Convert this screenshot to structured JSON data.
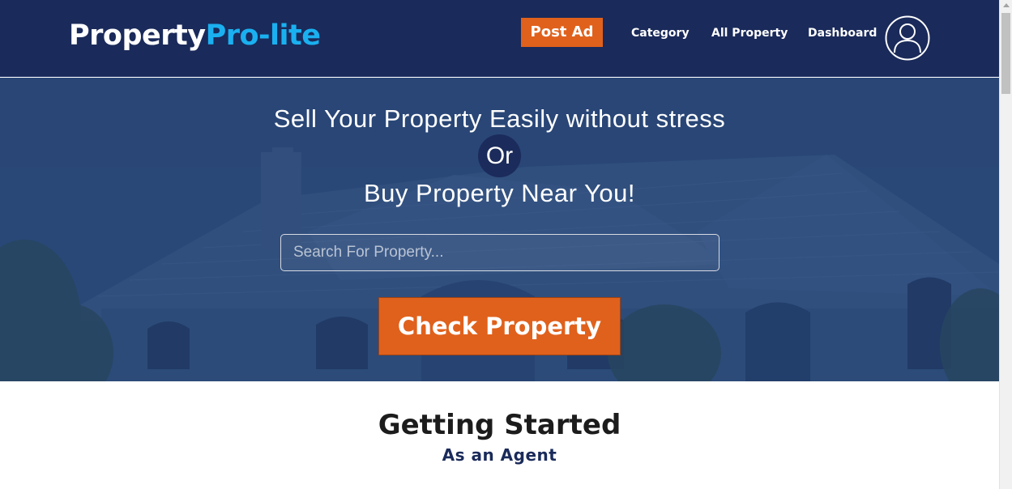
{
  "header": {
    "logo_part1": "Property",
    "logo_part2": "Pro-lite",
    "post_ad_label": "Post Ad",
    "nav": {
      "category": "Category",
      "all_property": "All Property",
      "dashboard": "Dashboard"
    },
    "avatar_icon": "user-avatar-icon"
  },
  "hero": {
    "line1": "Sell Your Property Easily without stress",
    "or": "Or",
    "line3": "Buy Property Near You!",
    "search_placeholder": "Search For Property...",
    "search_value": "",
    "check_button_label": "Check Property"
  },
  "getting_started": {
    "title": "Getting Started",
    "subtitle": "As an Agent"
  },
  "colors": {
    "header_bg": "#1a2a5a",
    "accent_orange": "#e0611c",
    "logo_blue": "#1ab0f0",
    "hero_overlay": "#2f4c76"
  }
}
